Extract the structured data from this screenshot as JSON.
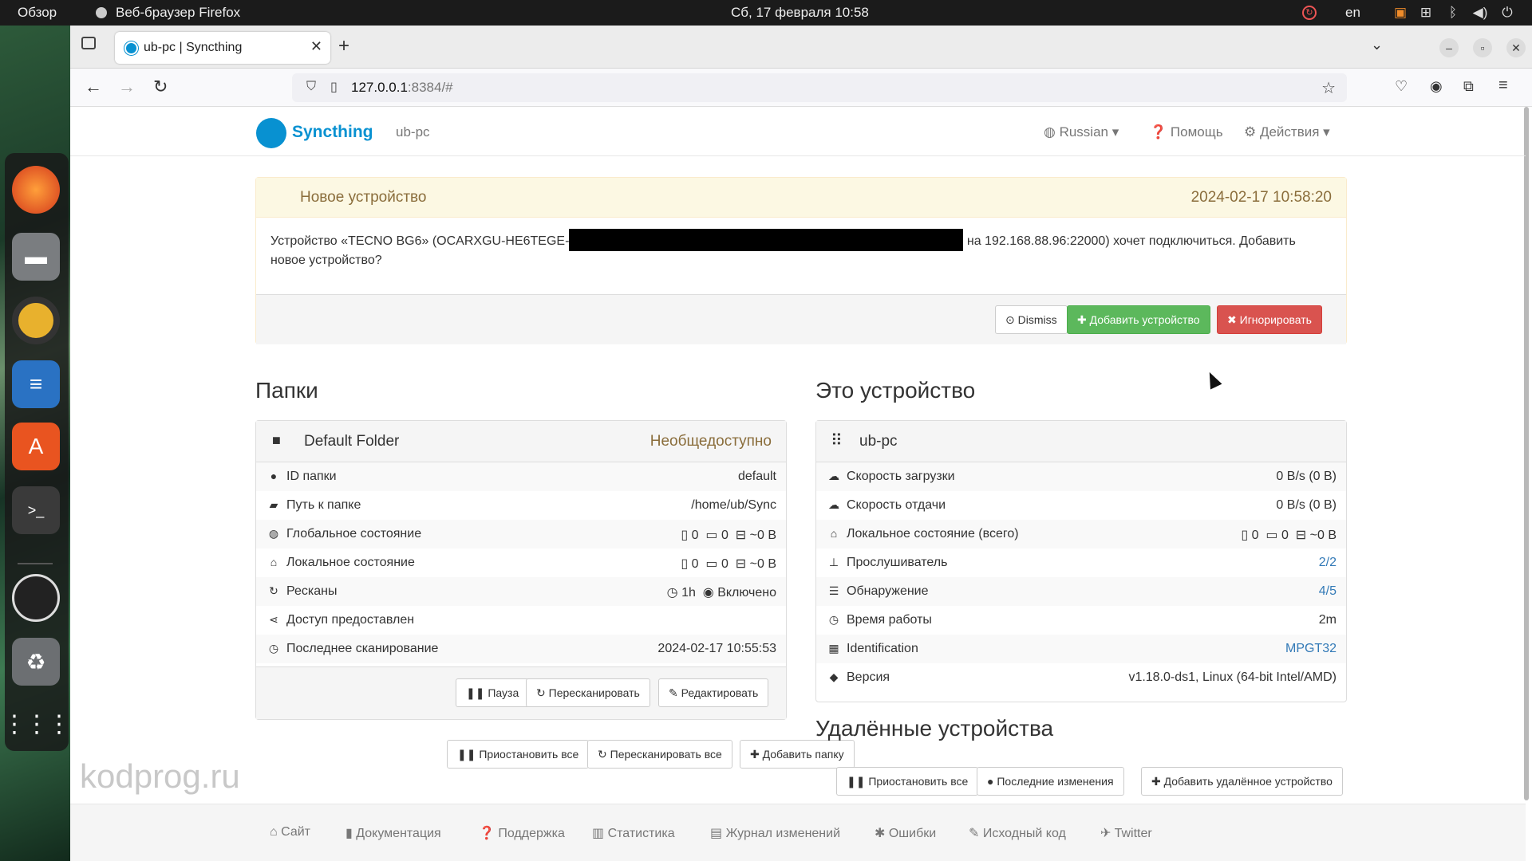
{
  "topbar": {
    "activities": "Обзор",
    "app_name": "Веб-браузер Firefox",
    "clock": "Сб, 17 февраля  10:58",
    "lang": "en"
  },
  "browser": {
    "tab_title": "ub-pc | Syncthing",
    "url_host": "127.0.0.1",
    "url_rest": ":8384/#"
  },
  "syncthing": {
    "logo": "Syncthing",
    "device": "ub-pc",
    "menu": {
      "language": "Russian",
      "help": "Помощь",
      "actions": "Действия"
    },
    "notice": {
      "title": "Новое устройство",
      "time": "2024-02-17 10:58:20",
      "text_before": "Устройство «TECNO BG6» (OCARXGU-HE6TEGE-",
      "text_after": "на 192.168.88.96:22000) хочет подключиться. Добавить новое устройство?",
      "dismiss": "Dismiss",
      "add": "Добавить устройство",
      "ignore": "Игнорировать"
    },
    "folders": {
      "heading": "Папки",
      "folder_name": "Default Folder",
      "folder_status": "Необщедоступно",
      "rows": {
        "id": {
          "label": "ID папки",
          "value": "default"
        },
        "path": {
          "label": "Путь к папке",
          "value": "/home/ub/Sync"
        },
        "global": {
          "label": "Глобальное состояние",
          "files": "0",
          "dirs": "0",
          "size": "~0 B"
        },
        "local": {
          "label": "Локальное состояние",
          "files": "0",
          "dirs": "0",
          "size": "~0 B"
        },
        "rescan": {
          "label": "Ресканы",
          "interval": "1h",
          "watch": "Включено"
        },
        "shared": {
          "label": "Доступ предоставлен"
        },
        "last_scan": {
          "label": "Последнее сканирование",
          "value": "2024-02-17 10:55:53"
        }
      },
      "btn_pause": "Пауза",
      "btn_rescan": "Пересканировать",
      "btn_edit": "Редактировать",
      "btn_pause_all": "Приостановить все",
      "btn_rescan_all": "Пересканировать все",
      "btn_add_folder": "Добавить папку"
    },
    "this_device": {
      "heading": "Это устройство",
      "name": "ub-pc",
      "rows": {
        "download": {
          "label": "Скорость загрузки",
          "value": "0 B/s (0 B)"
        },
        "upload": {
          "label": "Скорость отдачи",
          "value": "0 B/s (0 B)"
        },
        "local_total": {
          "label": "Локальное состояние (всего)",
          "files": "0",
          "dirs": "0",
          "size": "~0 B"
        },
        "listener": {
          "label": "Прослушиватель",
          "value": "2/2"
        },
        "discovery": {
          "label": "Обнаружение",
          "value": "4/5"
        },
        "uptime": {
          "label": "Время работы",
          "value": "2m"
        },
        "identification": {
          "label": "Identification",
          "value": "MPGT32"
        },
        "version": {
          "label": "Версия",
          "value": "v1.18.0-ds1, Linux (64-bit Intel/AMD)"
        }
      }
    },
    "remote": {
      "heading": "Удалённые устройства",
      "btn_pause_all": "Приостановить все",
      "btn_recent": "Последние изменения",
      "btn_add_remote": "Добавить удалённое устройство"
    },
    "footer": [
      "Сайт",
      "Документация",
      "Поддержка",
      "Статистика",
      "Журнал изменений",
      "Ошибки",
      "Исходный код",
      "Twitter"
    ]
  },
  "watermark": "kodprog.ru"
}
